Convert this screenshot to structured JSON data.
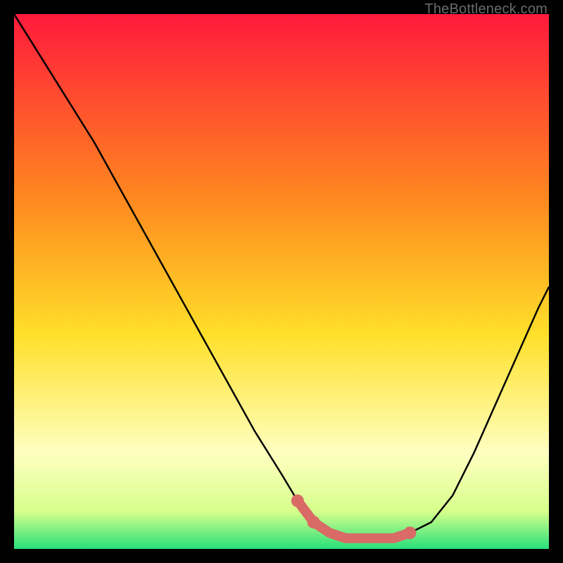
{
  "watermark": "TheBottleneck.com",
  "colors": {
    "bg": "#000000",
    "gradient_top": "#ff1a3c",
    "gradient_mid1": "#ff8a1f",
    "gradient_mid2": "#ffe02a",
    "gradient_light": "#ffffc0",
    "gradient_green": "#27e07a",
    "curve": "#000000",
    "marker_fill": "#d96a66",
    "marker_stroke": "#d96a66"
  },
  "chart_data": {
    "type": "line",
    "title": "",
    "xlabel": "",
    "ylabel": "",
    "xlim": [
      0,
      100
    ],
    "ylim": [
      0,
      100
    ],
    "series": [
      {
        "name": "bottleneck-curve",
        "x": [
          0,
          5,
          10,
          15,
          20,
          25,
          30,
          35,
          40,
          45,
          50,
          53,
          56,
          59,
          62,
          65,
          68,
          71,
          74,
          78,
          82,
          86,
          90,
          94,
          98,
          100
        ],
        "y": [
          100,
          92,
          84,
          76,
          67,
          58,
          49,
          40,
          31,
          22,
          14,
          9,
          5,
          3,
          2,
          2,
          2,
          2,
          3,
          5,
          10,
          18,
          27,
          36,
          45,
          49
        ]
      }
    ],
    "optimal_markers": {
      "name": "optimal-range",
      "x": [
        53,
        56,
        59,
        62,
        65,
        68,
        71,
        74
      ],
      "y": [
        9,
        5,
        3,
        2,
        2,
        2,
        2,
        3
      ]
    }
  }
}
